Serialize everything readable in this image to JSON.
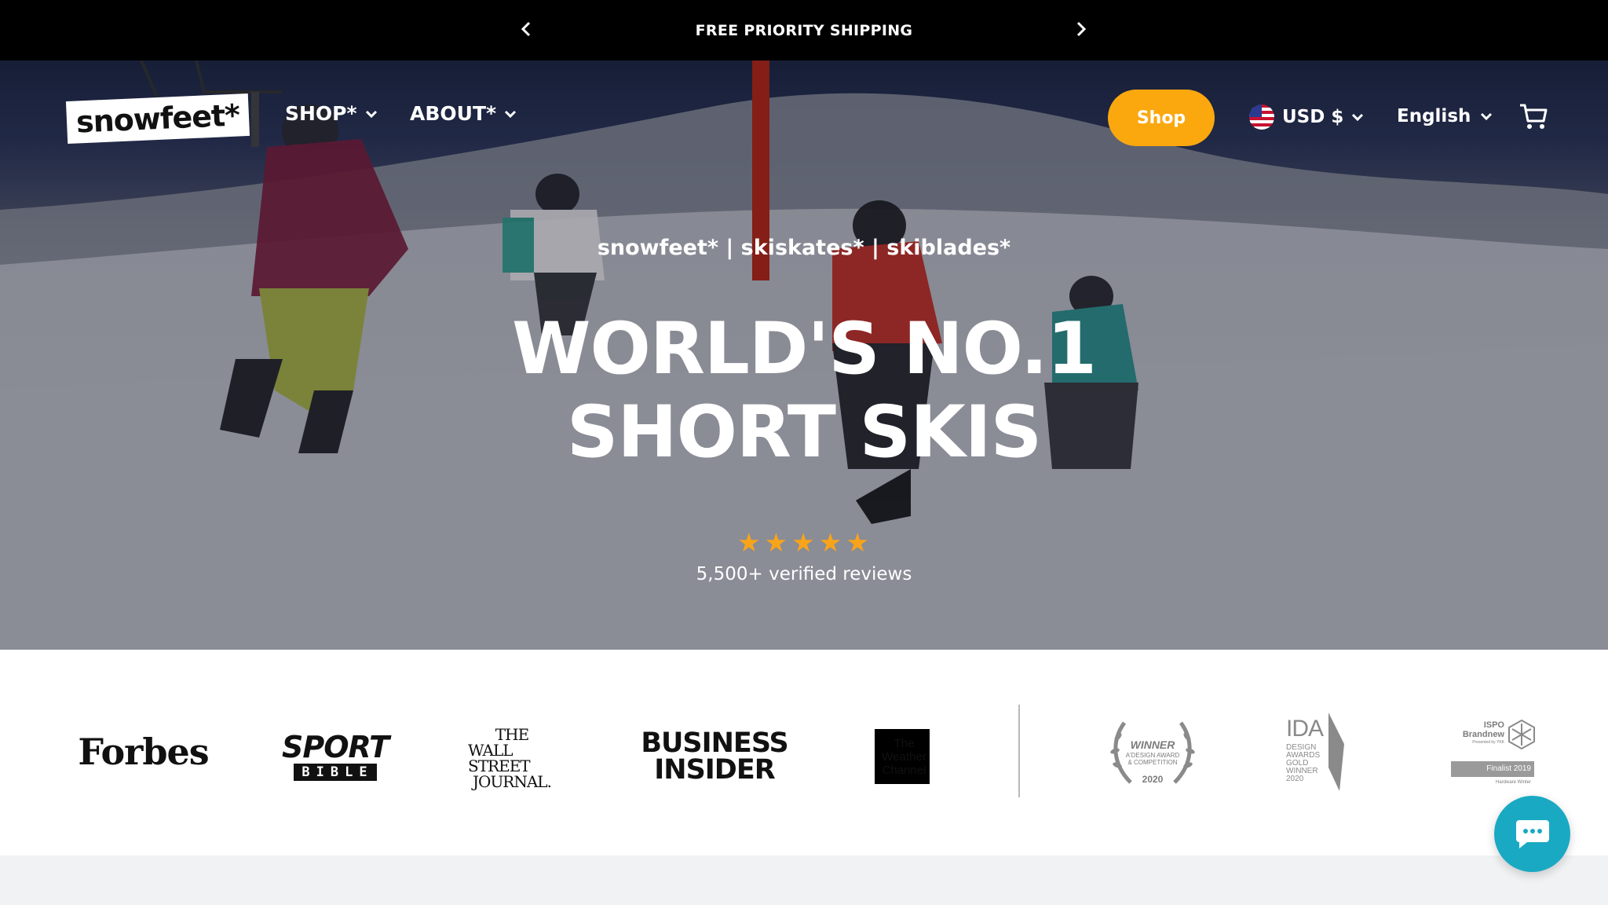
{
  "announcement": {
    "message": "FREE PRIORITY SHIPPING",
    "prev_icon": "chevron-left-icon",
    "next_icon": "chevron-right-icon"
  },
  "header": {
    "logo_text": "snowfeet*",
    "nav": [
      {
        "label": "SHOP*"
      },
      {
        "label": "ABOUT*"
      }
    ],
    "shop_button": "Shop",
    "currency": {
      "label": "USD $",
      "flag": "us-flag-icon"
    },
    "language": "English",
    "cart_icon": "cart-icon"
  },
  "hero": {
    "kicker": "snowfeet* | skiskates* | skiblades*",
    "headline_line1": "WORLD'S NO.1",
    "headline_line2": "SHORT SKIS",
    "rating_stars": 5,
    "reviews": "5,500+ verified reviews"
  },
  "press": {
    "forbes": "Forbes",
    "sport_bible_1": "SPORT",
    "sport_bible_2": "BIBLE",
    "wsj_1": "THE",
    "wsj_2": "WALL STREET",
    "wsj_3": "JOURNAL.",
    "bi_1": "BUSINESS",
    "bi_2": "INSIDER",
    "twc_1": "The",
    "twc_2": "Weather",
    "twc_3": "Channel",
    "award_winner": {
      "title": "WINNER",
      "line1": "A'DESIGN AWARD",
      "line2": "& COMPETITION",
      "year": "2020"
    },
    "award_ida": {
      "title": "IDA",
      "l1": "DESIGN",
      "l2": "AWARDS",
      "l3": "GOLD",
      "l4": "WINNER",
      "l5": "2020"
    },
    "award_ispo": {
      "l1": "ISPO",
      "l2": "Brandnew",
      "l3": "Presented by YKK",
      "l4": "Finalist 2019",
      "l5": "Hardware Winter"
    }
  },
  "colors": {
    "accent": "#fba80f",
    "star": "#f7a41b",
    "chat": "#1aa9c3"
  },
  "chat_icon": "chat-bubble-icon"
}
